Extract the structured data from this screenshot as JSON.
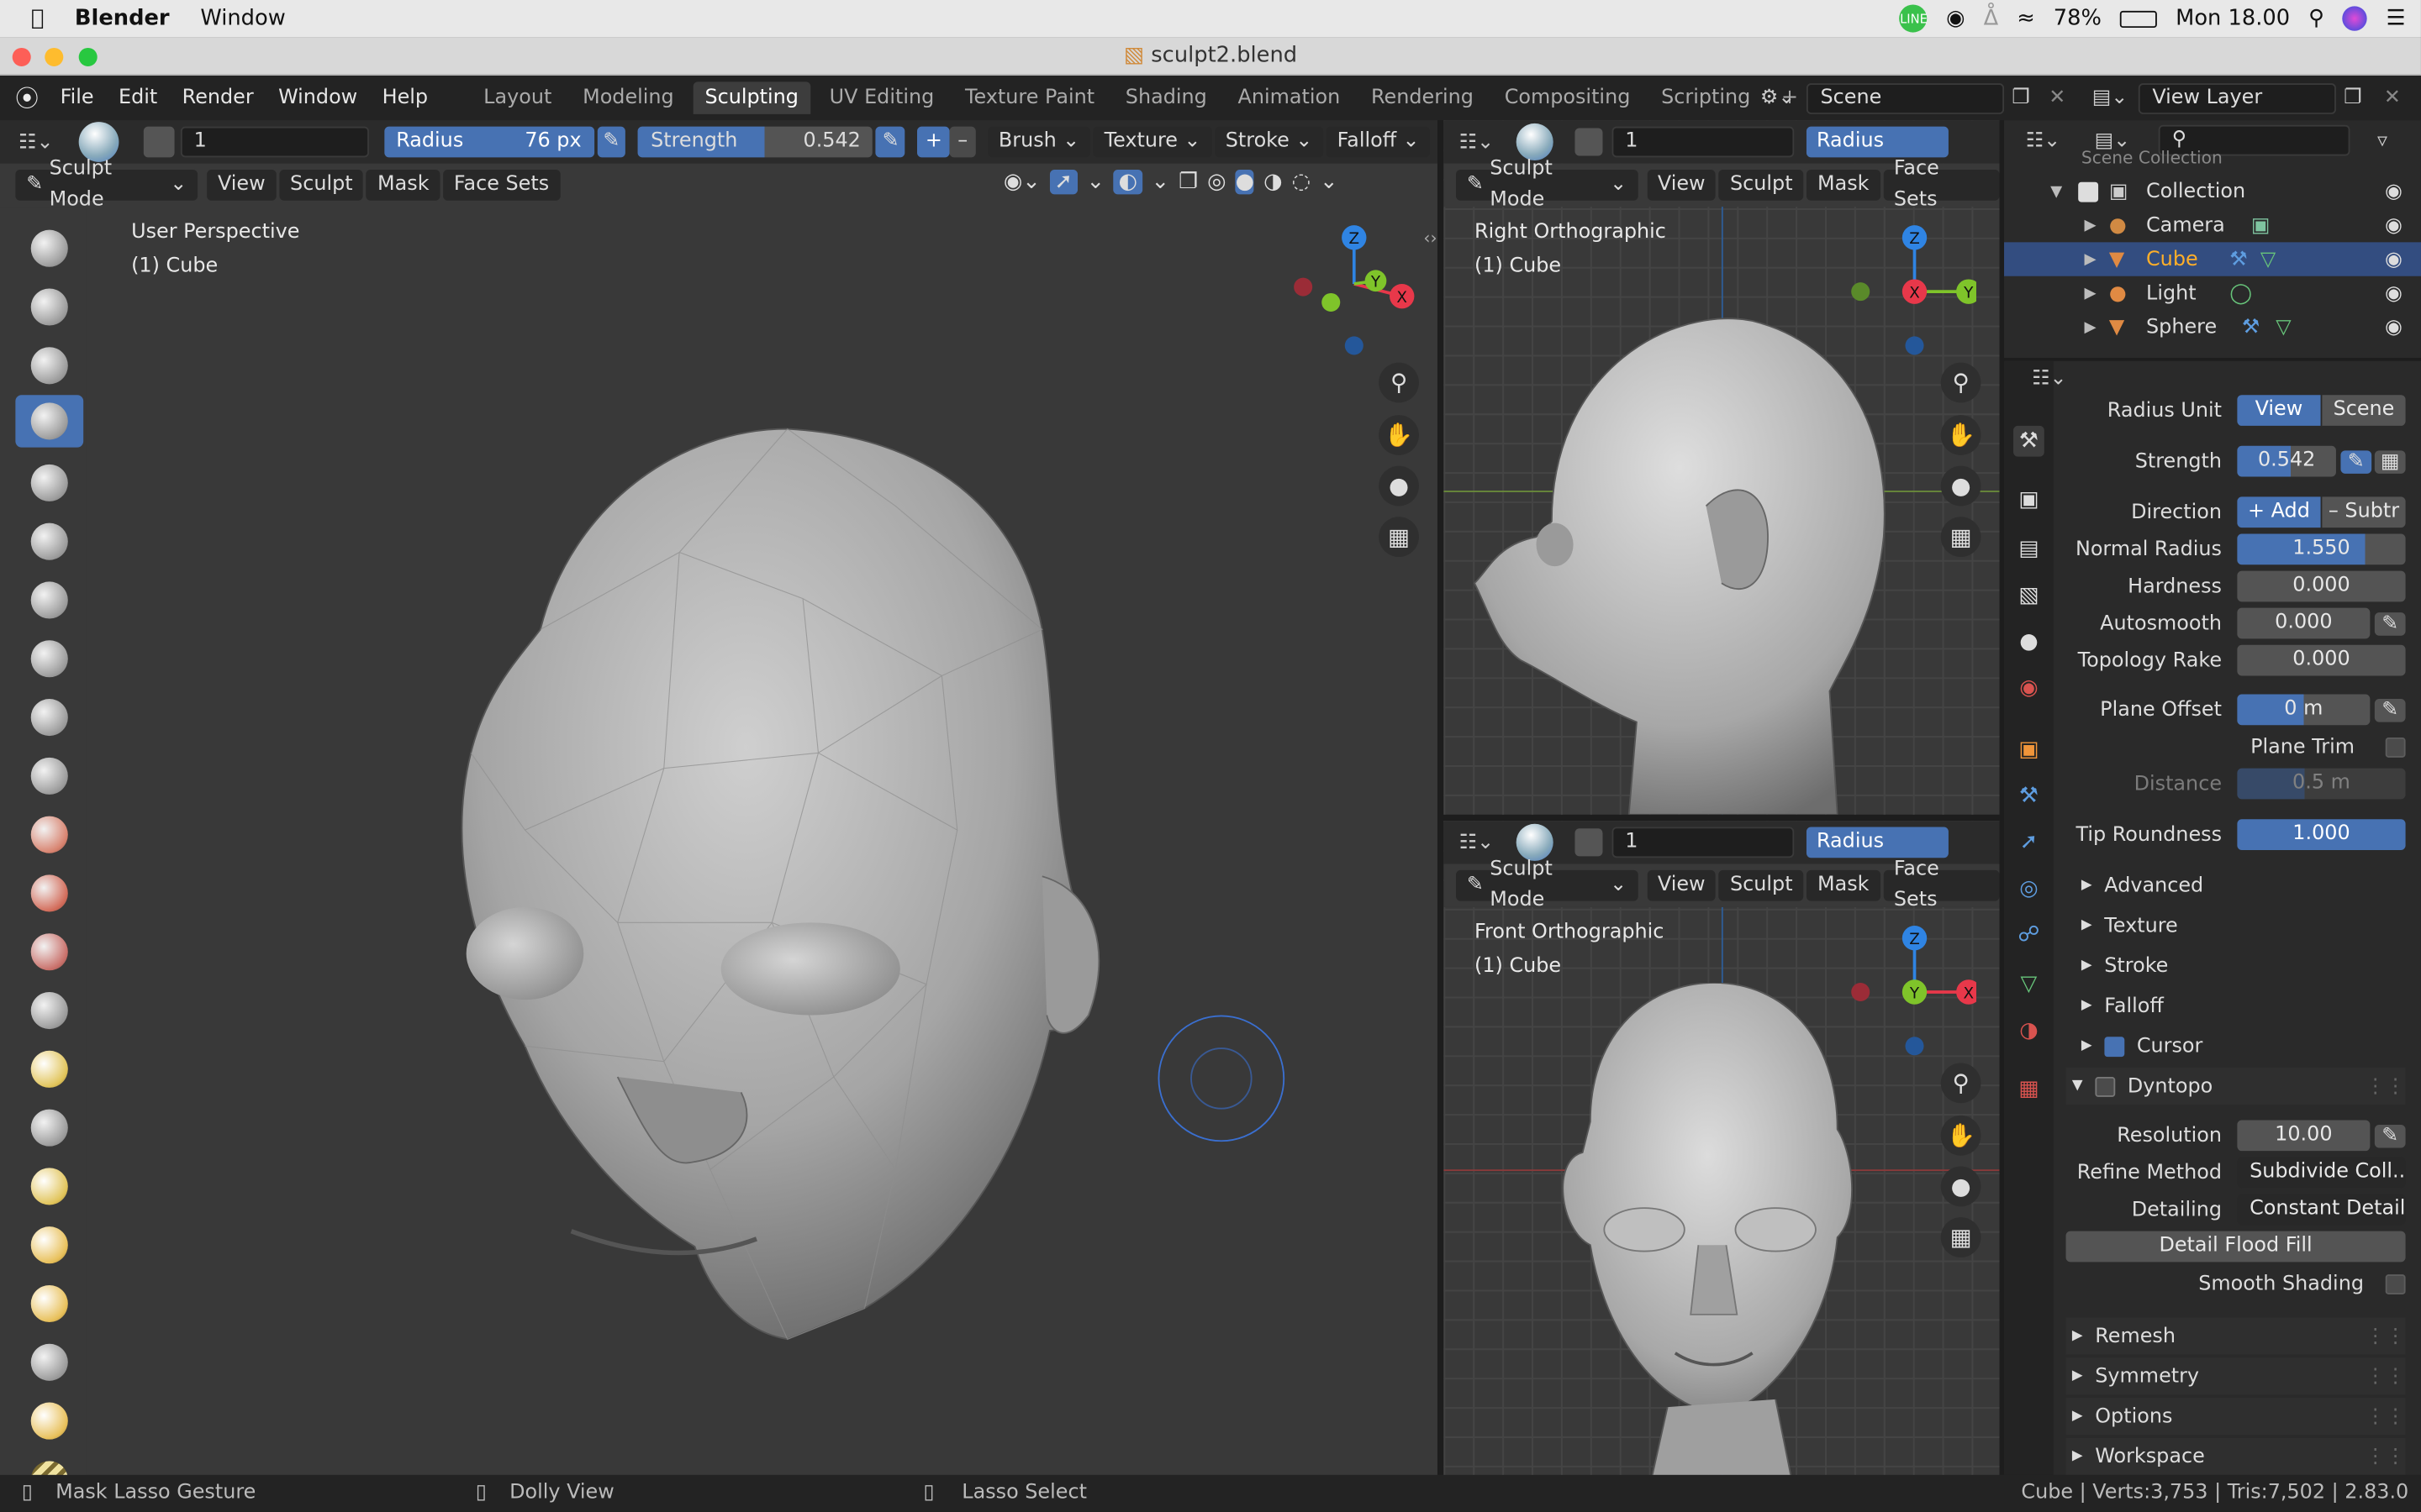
{
  "macbar": {
    "app": "Blender",
    "menu": "Window",
    "battery": "78%",
    "clock": "Mon 18.00"
  },
  "window": {
    "title": "sculpt2.blend"
  },
  "menus": [
    "File",
    "Edit",
    "Render",
    "Window",
    "Help"
  ],
  "workspaces": [
    "Layout",
    "Modeling",
    "Sculpting",
    "UV Editing",
    "Texture Paint",
    "Shading",
    "Animation",
    "Rendering",
    "Compositing",
    "Scripting"
  ],
  "scene": "Scene",
  "view_layer": "View Layer",
  "tool_header": {
    "brush_num": "1",
    "radius_label": "Radius",
    "radius_value": "76 px",
    "strength_label": "Strength",
    "strength_value": "0.542",
    "plus": "+",
    "minus": "–",
    "brush": "Brush",
    "texture": "Texture",
    "stroke": "Stroke",
    "falloff": "Falloff"
  },
  "view_header": {
    "mode": "Sculpt Mode",
    "view": "View",
    "sculpt": "Sculpt",
    "mask": "Mask",
    "face_sets": "Face Sets"
  },
  "vp_main": {
    "line1": "User Perspective",
    "line2": "(1) Cube"
  },
  "vp_right": {
    "line1": "Right Orthographic",
    "line2": "(1) Cube"
  },
  "vp_front": {
    "line1": "Front Orthographic",
    "line2": "(1) Cube"
  },
  "small_header": {
    "num": "1",
    "radius": "Radius"
  },
  "gizmo": {
    "x": "X",
    "y": "Y",
    "z": "Z"
  },
  "outliner": {
    "collection_cut": "Scene Collection",
    "items": [
      {
        "name": "Collection"
      },
      {
        "name": "Camera"
      },
      {
        "name": "Cube"
      },
      {
        "name": "Light"
      },
      {
        "name": "Sphere"
      }
    ]
  },
  "props": {
    "radius_unit": {
      "label": "Radius Unit",
      "a": "View",
      "b": "Scene"
    },
    "strength": {
      "label": "Strength",
      "value": "0.542"
    },
    "direction": {
      "label": "Direction",
      "a": "+ Add",
      "b": "– Subtr"
    },
    "normal_radius": {
      "label": "Normal Radius",
      "value": "1.550"
    },
    "hardness": {
      "label": "Hardness",
      "value": "0.000"
    },
    "autosmooth": {
      "label": "Autosmooth",
      "value": "0.000"
    },
    "topology_rake": {
      "label": "Topology Rake",
      "value": "0.000"
    },
    "plane_offset": {
      "label": "Plane Offset",
      "value": "0 m"
    },
    "plane_trim": "Plane Trim",
    "distance": {
      "label": "Distance",
      "value": "0.5 m"
    },
    "tip_roundness": {
      "label": "Tip Roundness",
      "value": "1.000"
    },
    "sections": [
      "Advanced",
      "Texture",
      "Stroke",
      "Falloff",
      "Cursor"
    ],
    "dyntopo": "Dyntopo",
    "resolution": {
      "label": "Resolution",
      "value": "10.00"
    },
    "refine_method": {
      "label": "Refine Method",
      "value": "Subdivide Coll..."
    },
    "detailing": {
      "label": "Detailing",
      "value": "Constant Detail"
    },
    "detail_flood_fill": "Detail Flood Fill",
    "smooth_shading": "Smooth Shading",
    "more_sections": [
      "Remesh",
      "Symmetry",
      "Options",
      "Workspace"
    ]
  },
  "status": {
    "left": "Mask Lasso Gesture",
    "mid": "Dolly View",
    "right": "Lasso Select",
    "stats": "Cube | Verts:3,753 | Tris:7,502 | 2.83.0"
  },
  "colors": {
    "accent": "#4772b3",
    "x_axis": "#e8384a",
    "y_axis": "#7fc42a",
    "z_axis": "#2f84e3"
  }
}
